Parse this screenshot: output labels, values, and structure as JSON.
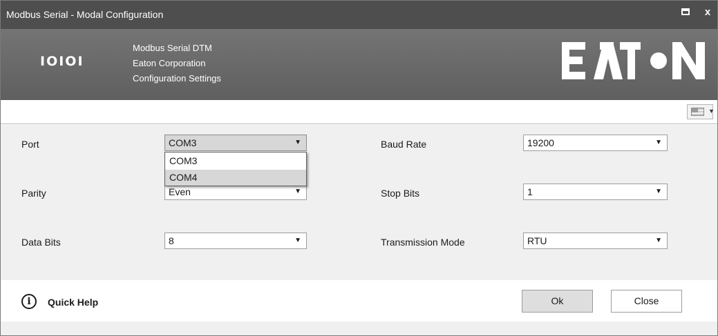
{
  "window": {
    "title": "Modbus Serial - Modal Configuration",
    "maximize_icon": "maximize-icon",
    "close_glyph": "x"
  },
  "header": {
    "binary_icon_text": "IOIOI",
    "line1": "Modbus Serial DTM",
    "line2": "Eaton Corporation",
    "line3": "Configuration Settings",
    "logo_text": "EATON",
    "background_color": "#5f5f5f"
  },
  "toolbar": {
    "language_icon": "flag-icon"
  },
  "form": {
    "port": {
      "label": "Port",
      "value": "COM3",
      "options": [
        "COM3",
        "COM4"
      ],
      "highlighted_option": "COM4"
    },
    "parity": {
      "label": "Parity",
      "value": "Even"
    },
    "data_bits": {
      "label": "Data Bits",
      "value": "8"
    },
    "baud_rate": {
      "label": "Baud Rate",
      "value": "19200"
    },
    "stop_bits": {
      "label": "Stop Bits",
      "value": "1"
    },
    "transmission_mode": {
      "label": "Transmission Mode",
      "value": "RTU"
    }
  },
  "footer": {
    "help_icon": "info-icon",
    "help_label": "Quick Help",
    "ok_label": "Ok",
    "close_label": "Close"
  }
}
